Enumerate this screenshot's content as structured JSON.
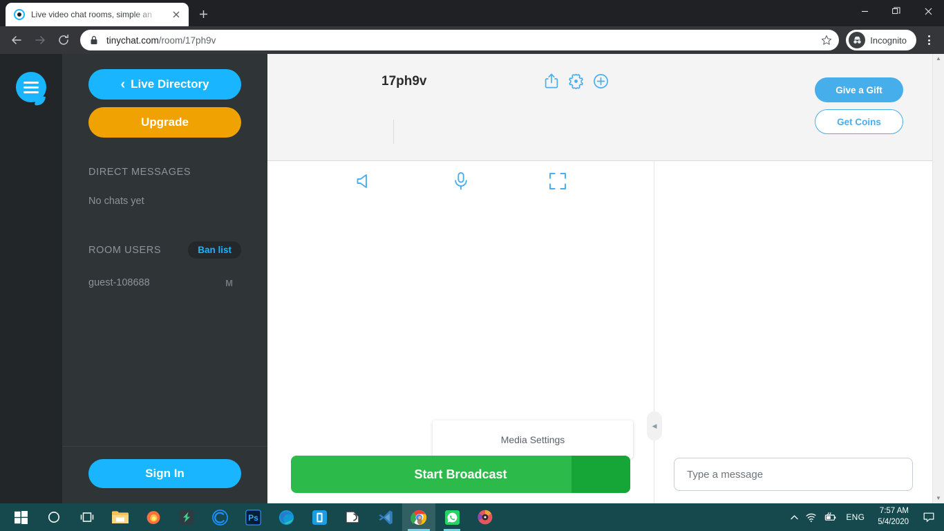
{
  "browser": {
    "tab": {
      "title": "Live video chat rooms, simple an",
      "favicon_icon": "tinychat-dot-icon",
      "close_icon": "close-icon"
    },
    "new_tab_icon": "plus-icon",
    "window_controls": {
      "minimize_icon": "minimize-icon",
      "restore_icon": "restore-icon",
      "close_icon": "close-icon"
    },
    "toolbar": {
      "back_icon": "back-arrow-icon",
      "forward_icon": "forward-arrow-icon",
      "reload_icon": "reload-icon",
      "lock_icon": "lock-icon",
      "url_host": "tinychat.com",
      "url_path": "/room/17ph9v",
      "star_icon": "star-icon",
      "profile_label": "Incognito",
      "profile_icon": "incognito-icon",
      "menu_icon": "three-dots-menu-icon"
    }
  },
  "sidebar": {
    "logo_icon": "chat-bubble-menu-icon",
    "live_directory_label": "Live Directory",
    "live_directory_chevron": "chevron-left-icon",
    "upgrade_label": "Upgrade",
    "direct_messages_heading": "DIRECT MESSAGES",
    "direct_messages_empty": "No chats yet",
    "room_users_heading": "ROOM USERS",
    "ban_list_label": "Ban list",
    "users": [
      {
        "name": "guest-108688",
        "badge": "M"
      }
    ],
    "sign_in_label": "Sign In"
  },
  "room": {
    "title": "17ph9v",
    "header_icons": [
      {
        "name": "share-icon"
      },
      {
        "name": "gear-icon"
      },
      {
        "name": "plus-circle-icon"
      }
    ],
    "give_gift_label": "Give a Gift",
    "get_coins_label": "Get Coins"
  },
  "media_controls": [
    {
      "name": "speaker-icon"
    },
    {
      "name": "microphone-icon"
    },
    {
      "name": "fullscreen-icon"
    }
  ],
  "broadcast": {
    "label": "Start Broadcast",
    "dropdown_icon": "caret-down-icon",
    "tooltip_label": "Media Settings"
  },
  "chat": {
    "input_placeholder": "Type a message",
    "input_value": "",
    "collapse_icon": "chevron-left-icon"
  },
  "scrollbar": {
    "up_icon": "caret-up-icon",
    "down_icon": "caret-down-icon"
  },
  "taskbar": {
    "items": [
      {
        "name": "start-button",
        "icon": "windows-logo-icon"
      },
      {
        "name": "search-button",
        "icon": "circle-icon"
      },
      {
        "name": "task-view-button",
        "icon": "task-view-icon"
      },
      {
        "name": "file-explorer",
        "icon": "folder-icon"
      },
      {
        "name": "firefox",
        "icon": "firefox-icon"
      },
      {
        "name": "diamond-app",
        "icon": "diamond-icon"
      },
      {
        "name": "c-app",
        "icon": "c-circle-icon"
      },
      {
        "name": "photoshop",
        "icon": "ps-icon"
      },
      {
        "name": "microsoft-edge",
        "icon": "edge-icon"
      },
      {
        "name": "phone-link",
        "icon": "phone-icon"
      },
      {
        "name": "snip-tool",
        "icon": "snip-icon"
      },
      {
        "name": "vs-code",
        "icon": "vscode-icon"
      },
      {
        "name": "google-chrome",
        "icon": "chrome-icon"
      },
      {
        "name": "whatsapp",
        "icon": "whatsapp-icon"
      },
      {
        "name": "media-app",
        "icon": "disc-icon"
      }
    ],
    "tray": {
      "chevron_icon": "chevron-up-icon",
      "wifi_icon": "wifi-icon",
      "battery_icon": "battery-icon",
      "language": "ENG",
      "time": "7:57 AM",
      "date": "5/4/2020",
      "action_center_icon": "speech-bubble-icon"
    }
  },
  "colors": {
    "accent_blue": "#19b5fe",
    "header_blue": "#45aeeb",
    "upgrade_orange": "#f0a202",
    "broadcast_green": "#2cbb4b",
    "broadcast_green_dark": "#16a637",
    "sidebar_dark": "#2f3437",
    "rail_dark": "#222629",
    "taskbar_teal": "#15494d"
  }
}
